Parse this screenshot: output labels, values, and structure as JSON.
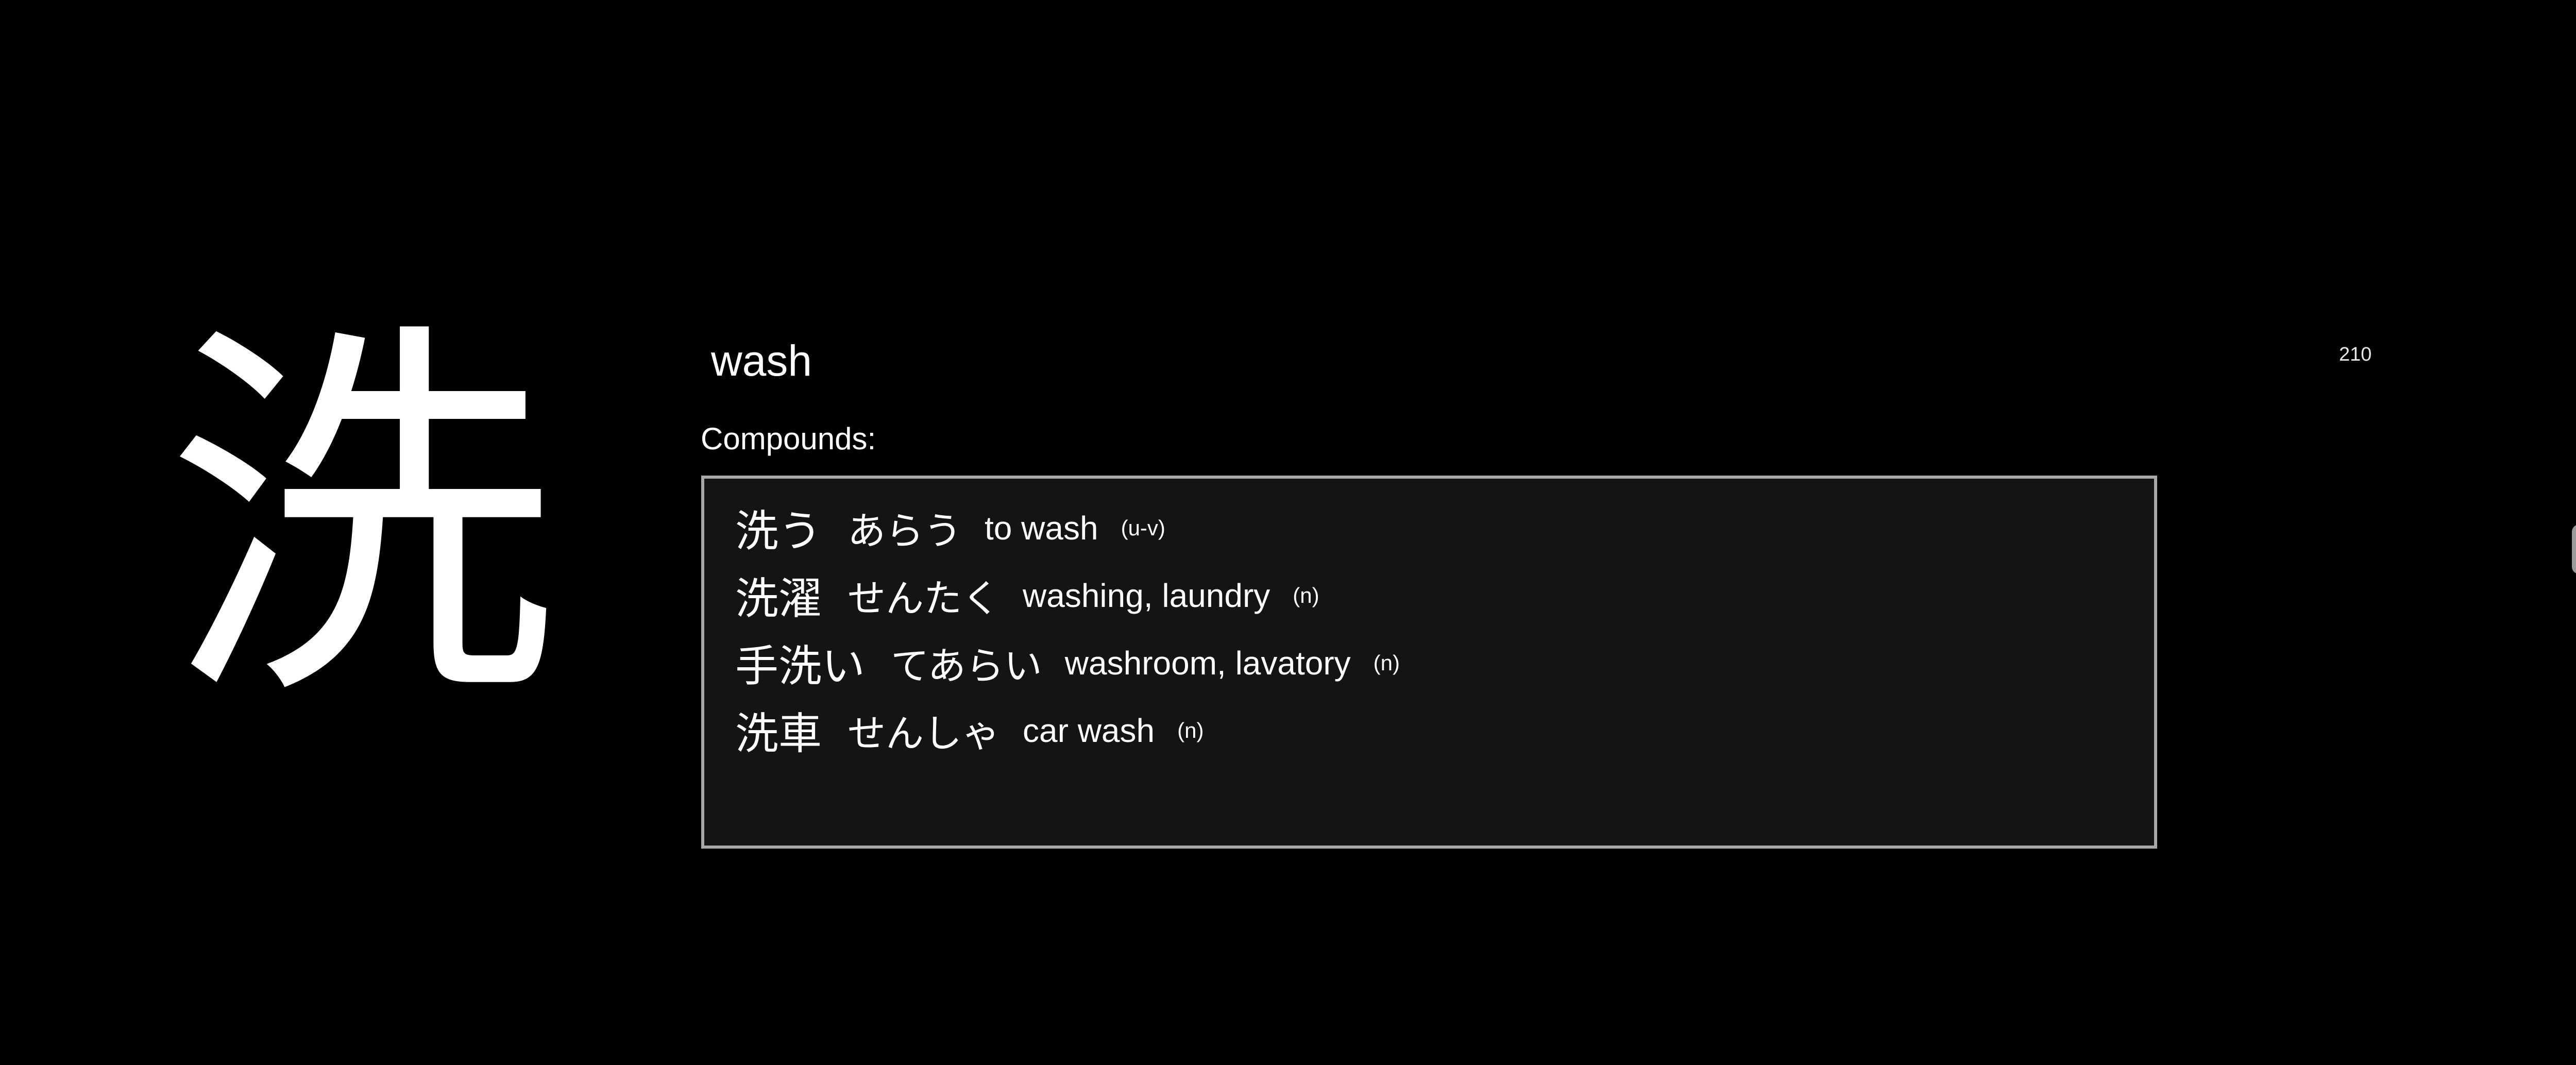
{
  "card": {
    "kanji": "洗",
    "meaning": "wash",
    "counter": "210",
    "compounds_label": "Compounds:",
    "compounds": [
      {
        "word": "洗う",
        "reading": "あらう",
        "gloss": "to wash",
        "pos": "(u-v)"
      },
      {
        "word": "洗濯",
        "reading": "せんたく",
        "gloss": "washing, laundry",
        "pos": "(n)"
      },
      {
        "word": "手洗い",
        "reading": "てあらい",
        "gloss": "washroom, lavatory",
        "pos": "(n)"
      },
      {
        "word": "洗車",
        "reading": "せんしゃ",
        "gloss": "car wash",
        "pos": "(n)"
      }
    ]
  },
  "colors": {
    "background": "#000000",
    "text": "#ffffff",
    "box_background": "#141414",
    "box_border": "#a8a8a8"
  }
}
